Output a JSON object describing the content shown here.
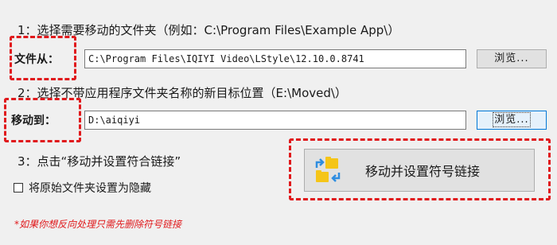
{
  "step1": {
    "label": "1：选择需要移动的文件夹（例如：C:\\Program Files\\Example App\\）"
  },
  "source": {
    "label": "文件从：",
    "value": "C:\\Program Files\\IQIYI Video\\LStyle\\12.10.0.8741",
    "browse_label": "浏览..."
  },
  "step2": {
    "label": "2：选择不带应用程序文件夹名称的新目标位置（E:\\Moved\\）"
  },
  "target": {
    "label": "移动到：",
    "value": "D:\\aiqiyi",
    "browse_label": "浏览..."
  },
  "step3": {
    "label": "3：点击“移动并设置符合链接”"
  },
  "hide_option": {
    "label": "将原始文件夹设置为隐藏",
    "checked": false
  },
  "main_button": {
    "label": "移动并设置符号链接",
    "icon": "move-symlink-icon"
  },
  "note": "*如果你想反向处理只需先删除符号链接",
  "colors": {
    "highlight": "#e0191c",
    "icon_yellow": "#f5c518",
    "icon_blue": "#2e8de0"
  }
}
